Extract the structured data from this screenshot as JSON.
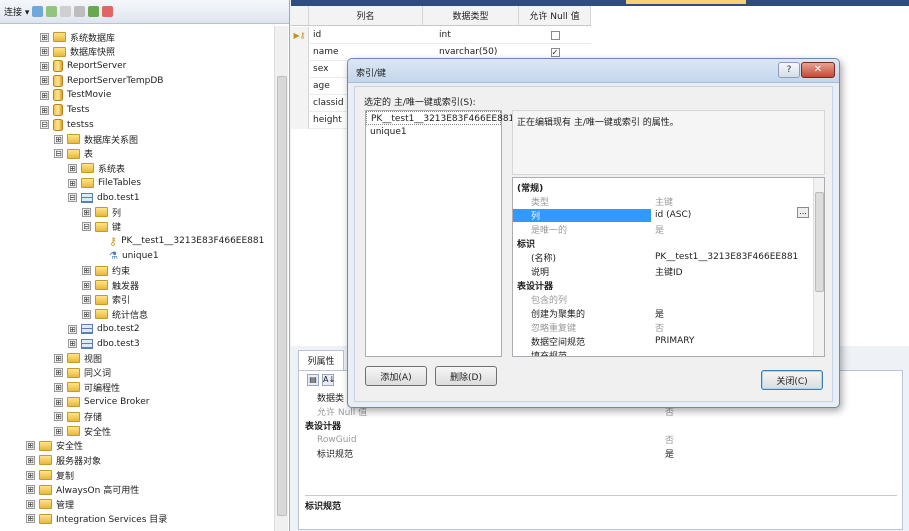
{
  "object_explorer": {
    "toolbar": {
      "connect_label": "连接 ▾"
    },
    "tree": [
      {
        "label": "系统数据库",
        "icon": "folder-icon",
        "exp": "⊞"
      },
      {
        "label": "数据库快照",
        "icon": "folder-icon",
        "exp": "⊞"
      },
      {
        "label": "ReportServer",
        "icon": "database-icon",
        "exp": "⊞"
      },
      {
        "label": "ReportServerTempDB",
        "icon": "database-icon",
        "exp": "⊞"
      },
      {
        "label": "TestMovie",
        "icon": "database-icon",
        "exp": "⊞"
      },
      {
        "label": "Tests",
        "icon": "database-icon",
        "exp": "⊞"
      },
      {
        "label": "testss",
        "icon": "database-icon",
        "exp": "⊟"
      },
      {
        "label": "数据库关系图",
        "icon": "folder-icon",
        "exp": "⊞"
      },
      {
        "label": "表",
        "icon": "folder-icon",
        "exp": "⊟"
      },
      {
        "label": "系统表",
        "icon": "folder-icon",
        "exp": "⊞"
      },
      {
        "label": "FileTables",
        "icon": "folder-icon",
        "exp": "⊞"
      },
      {
        "label": "dbo.test1",
        "icon": "table-icon",
        "exp": "⊟"
      },
      {
        "label": "列",
        "icon": "folder-icon",
        "exp": "⊞"
      },
      {
        "label": "键",
        "icon": "folder-icon",
        "exp": "⊟"
      },
      {
        "label": "PK__test1__3213E83F466EE881",
        "icon": "key-icon",
        "exp": ""
      },
      {
        "label": "unique1",
        "icon": "index-icon",
        "exp": ""
      },
      {
        "label": "约束",
        "icon": "folder-icon",
        "exp": "⊞"
      },
      {
        "label": "触发器",
        "icon": "folder-icon",
        "exp": "⊞"
      },
      {
        "label": "索引",
        "icon": "folder-icon",
        "exp": "⊞"
      },
      {
        "label": "统计信息",
        "icon": "folder-icon",
        "exp": "⊞"
      },
      {
        "label": "dbo.test2",
        "icon": "table-icon",
        "exp": "⊞"
      },
      {
        "label": "dbo.test3",
        "icon": "table-icon",
        "exp": "⊞"
      },
      {
        "label": "视图",
        "icon": "folder-icon",
        "exp": "⊞"
      },
      {
        "label": "同义词",
        "icon": "folder-icon",
        "exp": "⊞"
      },
      {
        "label": "可编程性",
        "icon": "folder-icon",
        "exp": "⊞"
      },
      {
        "label": "Service Broker",
        "icon": "folder-icon",
        "exp": "⊞"
      },
      {
        "label": "存储",
        "icon": "folder-icon",
        "exp": "⊞"
      },
      {
        "label": "安全性",
        "icon": "folder-icon",
        "exp": "⊞"
      },
      {
        "label": "安全性",
        "icon": "folder-icon",
        "exp": "⊞"
      },
      {
        "label": "服务器对象",
        "icon": "folder-icon",
        "exp": "⊞"
      },
      {
        "label": "复制",
        "icon": "folder-icon",
        "exp": "⊞"
      },
      {
        "label": "AlwaysOn 高可用性",
        "icon": "folder-icon",
        "exp": "⊞"
      },
      {
        "label": "管理",
        "icon": "folder-icon",
        "exp": "⊞"
      },
      {
        "label": "Integration Services 目录",
        "icon": "folder-icon",
        "exp": "⊞"
      }
    ]
  },
  "designer": {
    "headers": {
      "name": "列名",
      "type": "数据类型",
      "null": "允许 Null 值"
    },
    "rows": [
      {
        "name": "id",
        "type": "int",
        "null": false,
        "pk": true
      },
      {
        "name": "name",
        "type": "nvarchar(50)",
        "null": true
      },
      {
        "name": "sex",
        "type": "",
        "null": false
      },
      {
        "name": "age",
        "type": "",
        "null": false
      },
      {
        "name": "classid",
        "type": "",
        "null": false
      },
      {
        "name": "height",
        "type": "",
        "null": false
      }
    ]
  },
  "column_properties": {
    "tab": "列属性",
    "rows": [
      {
        "name": "数据类",
        "value": "",
        "gray": false,
        "cat": false
      },
      {
        "name": "允许 Null 值",
        "value": "否",
        "gray": true,
        "cat": false
      },
      {
        "name": "表设计器",
        "value": "",
        "gray": false,
        "cat": true
      },
      {
        "name": "RowGuid",
        "value": "否",
        "gray": true,
        "cat": false
      },
      {
        "name": "标识规范",
        "value": "是",
        "gray": false,
        "cat": false
      }
    ],
    "desc_title": "标识规范"
  },
  "dialog": {
    "title": "索引/键",
    "help": "?",
    "close_x": "✕",
    "select_label": "选定的 主/唯一键或索引(S):",
    "list": [
      "PK__test1__3213E83F466EE881",
      "unique1"
    ],
    "description": "正在编辑现有 主/唯一键或索引 的属性。",
    "properties": [
      {
        "name": "(常规)",
        "value": "",
        "cat": true
      },
      {
        "name": "类型",
        "value": "主键",
        "gray": true
      },
      {
        "name": "列",
        "value": "id (ASC)",
        "hl": true
      },
      {
        "name": "是唯一的",
        "value": "是",
        "gray": true
      },
      {
        "name": "标识",
        "value": "",
        "cat": true
      },
      {
        "name": "(名称)",
        "value": "PK__test1__3213E83F466EE881"
      },
      {
        "name": "说明",
        "value": "主键ID"
      },
      {
        "name": "表设计器",
        "value": "",
        "cat": true
      },
      {
        "name": "包含的列",
        "value": "",
        "gray": true
      },
      {
        "name": "创建为聚集的",
        "value": "是"
      },
      {
        "name": "忽略重复键",
        "value": "否",
        "gray": true
      },
      {
        "name": "数据空间规范",
        "value": "PRIMARY"
      },
      {
        "name": "填充规范",
        "value": ""
      }
    ],
    "ellipsis": "...",
    "add_button": "添加(A)",
    "delete_button": "删除(D)",
    "close_button": "关闭(C)"
  }
}
